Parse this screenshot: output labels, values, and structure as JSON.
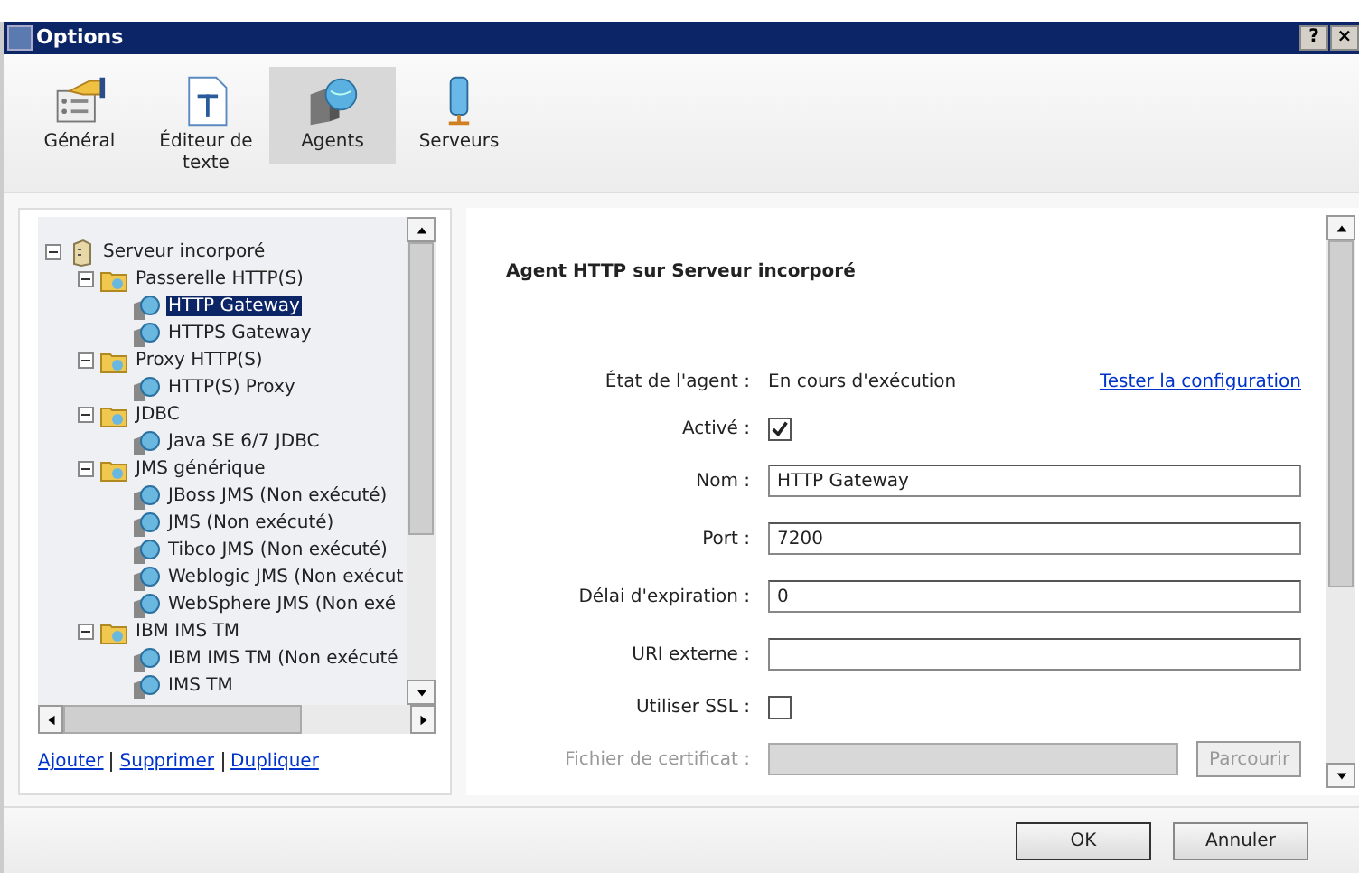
{
  "window": {
    "title": "Options",
    "buttons": [
      "?",
      "×"
    ]
  },
  "toolbar": [
    {
      "label": "Général",
      "kind": "general",
      "selected": false
    },
    {
      "label": "Éditeur de texte",
      "kind": "editor",
      "selected": false
    },
    {
      "label": "Agents",
      "kind": "agents",
      "selected": true
    },
    {
      "label": "Serveurs",
      "kind": "servers",
      "selected": false
    }
  ],
  "tree": [
    {
      "label": "Serveur incorporé",
      "kind": "server",
      "expanded": true,
      "selected": false,
      "children": [
        {
          "label": "Passerelle HTTP(S)",
          "kind": "folder",
          "expanded": true,
          "selected": false,
          "children": [
            {
              "label": "HTTP Gateway",
              "kind": "agent",
              "selected": true
            },
            {
              "label": "HTTPS Gateway",
              "kind": "agent",
              "selected": false
            }
          ]
        },
        {
          "label": "Proxy HTTP(S)",
          "kind": "folder",
          "expanded": true,
          "selected": false,
          "children": [
            {
              "label": "HTTP(S) Proxy",
              "kind": "agent",
              "selected": false
            }
          ]
        },
        {
          "label": "JDBC",
          "kind": "folder",
          "expanded": true,
          "selected": false,
          "children": [
            {
              "label": "Java SE 6/7 JDBC",
              "kind": "agent",
              "selected": false
            }
          ]
        },
        {
          "label": "JMS générique",
          "kind": "folder",
          "expanded": true,
          "selected": false,
          "children": [
            {
              "label": "JBoss JMS (Non exécuté)",
              "kind": "agent",
              "selected": false
            },
            {
              "label": "JMS (Non exécuté)",
              "kind": "agent",
              "selected": false
            },
            {
              "label": "Tibco JMS (Non exécuté)",
              "kind": "agent",
              "selected": false
            },
            {
              "label": "Weblogic JMS (Non exécut",
              "kind": "agent",
              "selected": false
            },
            {
              "label": "WebSphere JMS (Non exé",
              "kind": "agent",
              "selected": false
            }
          ]
        },
        {
          "label": "IBM IMS TM",
          "kind": "folder",
          "expanded": true,
          "selected": false,
          "children": [
            {
              "label": "IBM IMS TM (Non exécuté",
              "kind": "agent",
              "selected": false
            },
            {
              "label": "IMS TM",
              "kind": "agent",
              "selected": false
            }
          ]
        }
      ]
    }
  ],
  "tree_links": [
    "Ajouter",
    "Supprimer",
    "Dupliquer"
  ],
  "panel": {
    "title": "Agent HTTP sur Serveur incorporé",
    "rows": [
      {
        "kind": "status",
        "label": "État de l'agent :",
        "value": "En cours d'exécution",
        "link": "Tester la configuration"
      },
      {
        "kind": "checkbox",
        "label": "Activé :",
        "checked": true
      },
      {
        "kind": "text",
        "label": "Nom :",
        "value": "HTTP Gateway"
      },
      {
        "kind": "text",
        "label": "Port :",
        "value": "7200"
      },
      {
        "kind": "text",
        "label": "Délai d'expiration :",
        "value": "0"
      },
      {
        "kind": "text",
        "label": "URI externe :",
        "value": ""
      },
      {
        "kind": "checkbox",
        "label": "Utiliser SSL :",
        "checked": false
      },
      {
        "kind": "file",
        "label": "Fichier de certificat :",
        "disabled": true,
        "button": "Parcourir"
      }
    ]
  },
  "buttons": [
    "OK",
    "Annuler"
  ]
}
